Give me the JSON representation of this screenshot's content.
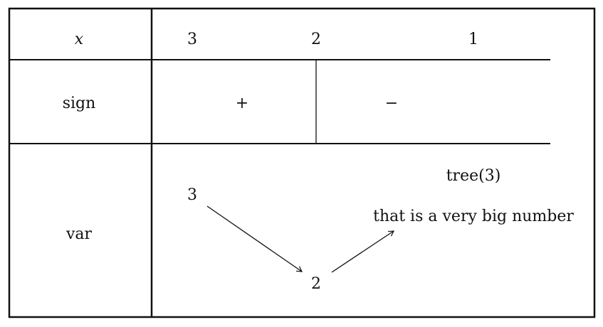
{
  "table": {
    "header": {
      "variable_label": "x",
      "values": [
        "3",
        "2",
        "1"
      ]
    },
    "sign_row": {
      "label": "sign",
      "signs": [
        "+",
        "−"
      ]
    },
    "variation_row": {
      "label": "var",
      "points": [
        "3",
        "2"
      ],
      "top_label": "tree(3)",
      "bottom_label": "that is a very big number"
    }
  }
}
